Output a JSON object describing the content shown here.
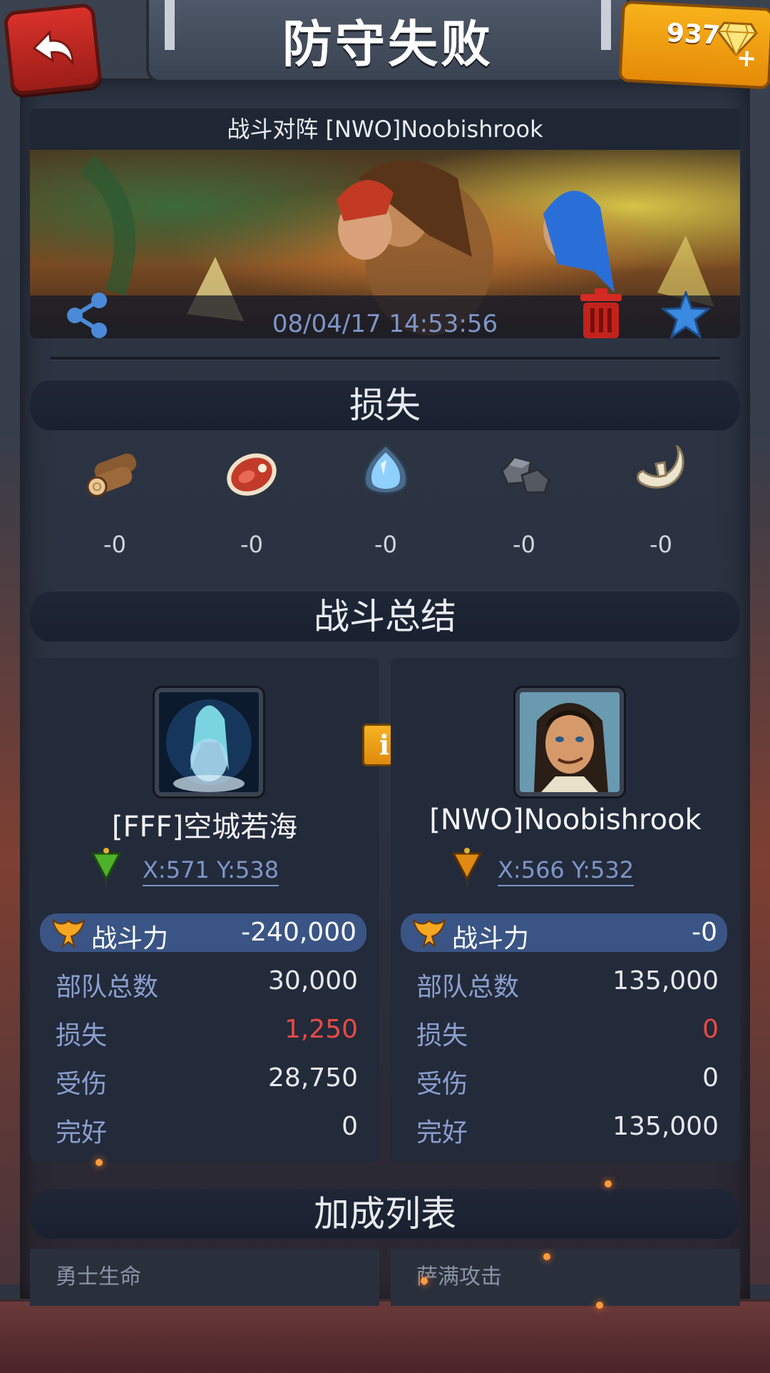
{
  "header": {
    "title": "防守失败",
    "gems": "937"
  },
  "battle": {
    "title": "战斗对阵 [NWO]Noobishrook",
    "datetime": "08/04/17 14:53:56"
  },
  "losses": {
    "title": "损失",
    "resources": [
      {
        "icon": "wood-icon",
        "value": "-0"
      },
      {
        "icon": "meat-icon",
        "value": "-0"
      },
      {
        "icon": "crystal-icon",
        "value": "-0"
      },
      {
        "icon": "stone-icon",
        "value": "-0"
      },
      {
        "icon": "bone-icon",
        "value": "-0"
      }
    ]
  },
  "summary": {
    "title": "战斗总结",
    "left": {
      "name": "[FFF]空城若海",
      "coords": "X:571 Y:538",
      "flag_color": "#4db12a",
      "power_label": "战斗力",
      "power_value": "-240,000",
      "rows": [
        {
          "label": "部队总数",
          "value": "30,000"
        },
        {
          "label": "损失",
          "value": "1,250"
        },
        {
          "label": "受伤",
          "value": "28,750"
        },
        {
          "label": "完好",
          "value": "0"
        }
      ]
    },
    "right": {
      "name": "[NWO]Noobishrook",
      "coords": "X:566 Y:532",
      "flag_color": "#e08a14",
      "power_label": "战斗力",
      "power_value": "-0",
      "rows": [
        {
          "label": "部队总数",
          "value": "135,000"
        },
        {
          "label": "损失",
          "value": "0"
        },
        {
          "label": "受伤",
          "value": "0"
        },
        {
          "label": "完好",
          "value": "135,000"
        }
      ]
    }
  },
  "bonus": {
    "title": "加成列表",
    "items": [
      "勇士生命",
      "萨满攻击"
    ]
  }
}
